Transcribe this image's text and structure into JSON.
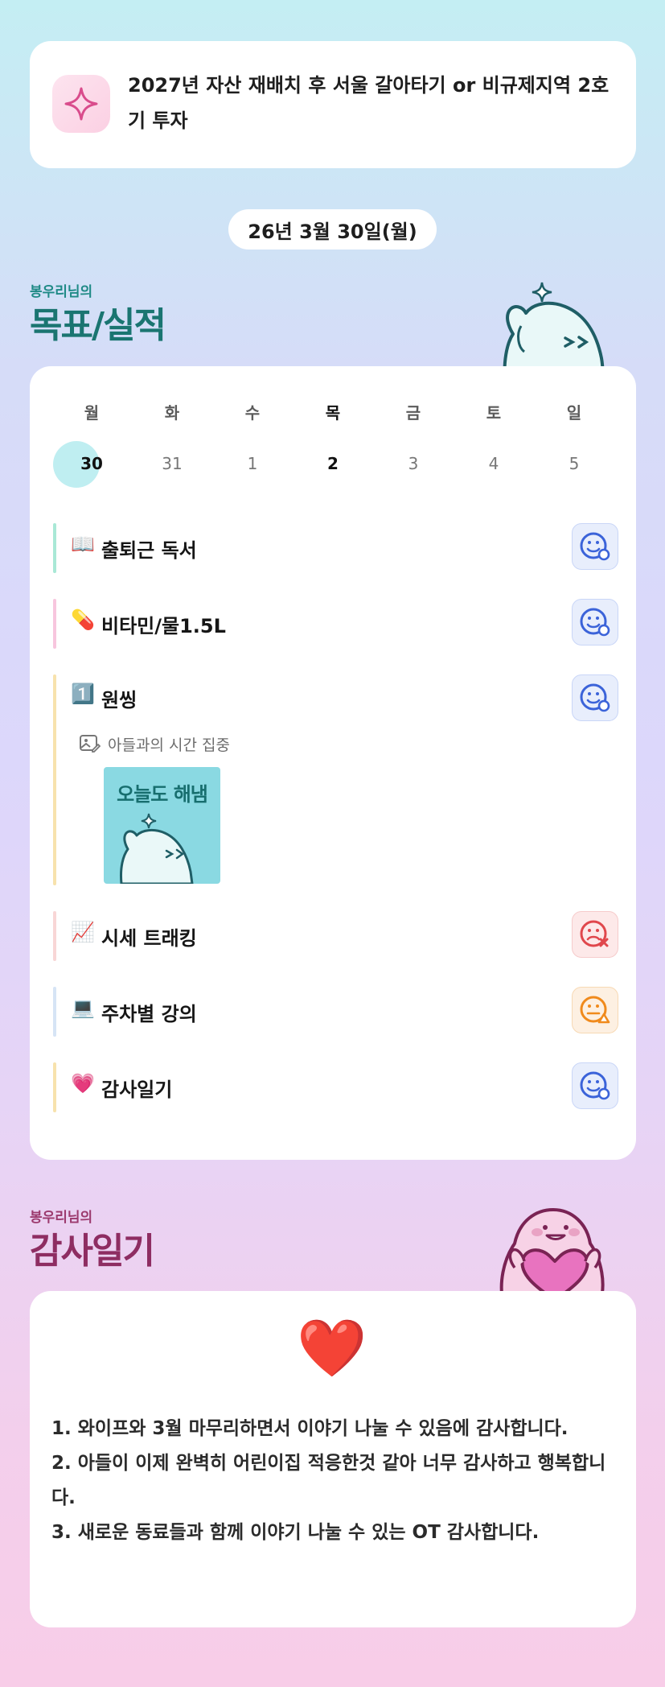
{
  "goal": {
    "icon": "sparkle-icon",
    "text": "2027년 자산 재배치 후 서울 갈아타기 or 비규제지역 2호기 투자"
  },
  "date": "26년 3월 30일(월)",
  "goals_section": {
    "subtitle": "봉우리님의",
    "title": "목표/실적"
  },
  "week": {
    "weekdays": [
      "월",
      "화",
      "수",
      "목",
      "금",
      "토",
      "일"
    ],
    "days": [
      "30",
      "31",
      "1",
      "2",
      "3",
      "4",
      "5"
    ]
  },
  "tasks": [
    {
      "emoji": "📖",
      "label": "출퇴근 독서",
      "status": "smile-done",
      "bar": "#a9e8d6"
    },
    {
      "emoji": "💊",
      "label": "비타민/물1.5L",
      "status": "smile-done",
      "bar": "#f7c6de"
    },
    {
      "emoji": "1️⃣",
      "label": "원씽",
      "status": "smile-done",
      "bar": "#f7e2ad",
      "memo": "아들과의 시간 집중",
      "photo_caption": "오늘도 해냄"
    },
    {
      "emoji": "📈",
      "label": "시세 트래킹",
      "status": "sad-fail",
      "bar": "#f8d6d6"
    },
    {
      "emoji": "💻",
      "label": "주차별 강의",
      "status": "meh-warning",
      "bar": "#d6e4f5"
    },
    {
      "emoji": "💗",
      "label": "감사일기",
      "status": "smile-done",
      "bar": "#f7e2ad"
    }
  ],
  "gratitude_section": {
    "subtitle": "봉우리님의",
    "title": "감사일기",
    "heart": "❤️",
    "lines": [
      "1. 와이프와 3월 마무리하면서 이야기 나눌 수 있음에 감사합니다.",
      "2. 아들이 이제 완벽히 어린이집 적응한것 같아 너무 감사하고 행복합니다.",
      "3. 새로운 동료들과 함께 이야기 나눌 수 있는 OT 감사합니다."
    ]
  },
  "colors": {
    "accent_teal": "#1a7571",
    "accent_plum": "#8e2d62",
    "face_blue": "#3b63d9",
    "face_red": "#e0474c",
    "face_orange": "#f08a1c"
  }
}
